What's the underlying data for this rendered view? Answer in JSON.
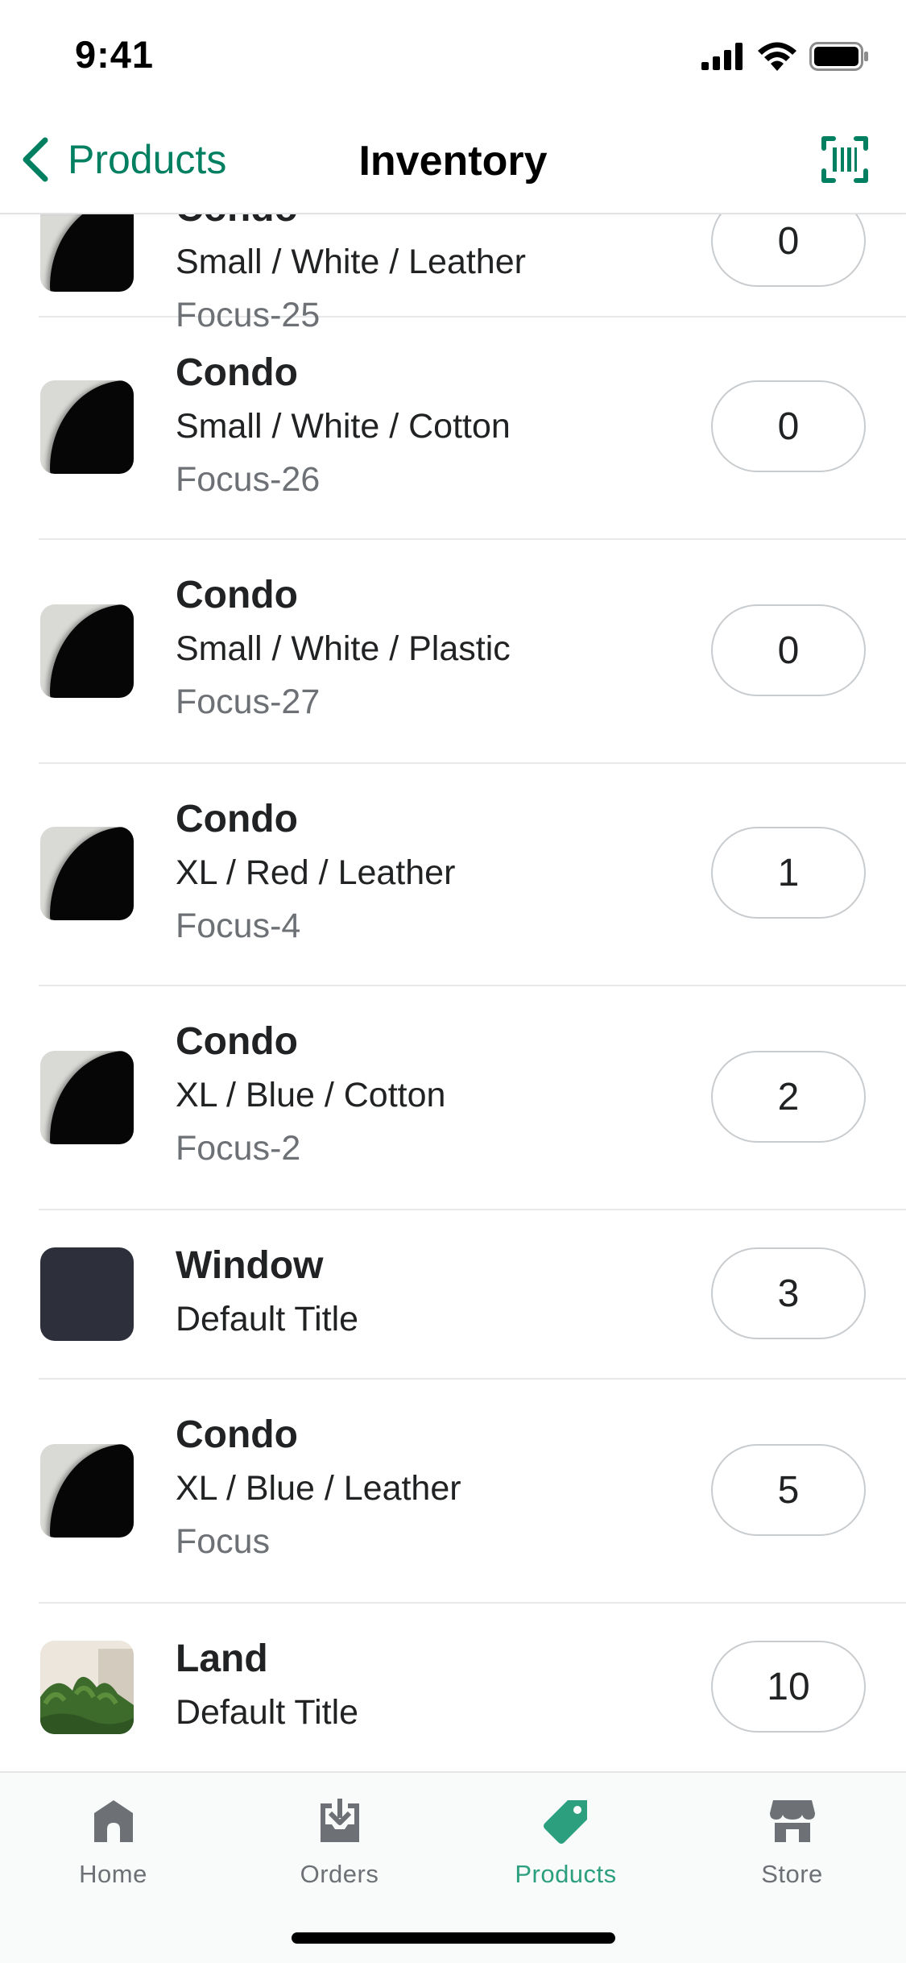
{
  "status_bar": {
    "time": "9:41"
  },
  "nav": {
    "back_label": "Products",
    "title": "Inventory",
    "accent_color": "#008060"
  },
  "rows": [
    {
      "title": "Condo",
      "variant": "Small / White / Leather",
      "sku": "Focus-25",
      "qty": "0",
      "thumb": "condo"
    },
    {
      "title": "Condo",
      "variant": "Small / White / Cotton",
      "sku": "Focus-26",
      "qty": "0",
      "thumb": "condo"
    },
    {
      "title": "Condo",
      "variant": "Small / White / Plastic",
      "sku": "Focus-27",
      "qty": "0",
      "thumb": "condo"
    },
    {
      "title": "Condo",
      "variant": "XL / Red / Leather",
      "sku": "Focus-4",
      "qty": "1",
      "thumb": "condo"
    },
    {
      "title": "Condo",
      "variant": "XL / Blue / Cotton",
      "sku": "Focus-2",
      "qty": "2",
      "thumb": "condo"
    },
    {
      "title": "Window",
      "variant": "Default Title",
      "sku": "",
      "qty": "3",
      "thumb": "window"
    },
    {
      "title": "Condo",
      "variant": "XL / Blue / Leather",
      "sku": "Focus",
      "qty": "5",
      "thumb": "condo"
    },
    {
      "title": "Land",
      "variant": "Default Title",
      "sku": "",
      "qty": "10",
      "thumb": "land"
    }
  ],
  "tabs": [
    {
      "label": "Home",
      "icon": "home-icon"
    },
    {
      "label": "Orders",
      "icon": "orders-icon"
    },
    {
      "label": "Products",
      "icon": "tag-icon",
      "active": true
    },
    {
      "label": "Store",
      "icon": "store-icon"
    }
  ],
  "colors": {
    "active_tab": "#2ca07e",
    "inactive_tab": "#6d7175"
  }
}
